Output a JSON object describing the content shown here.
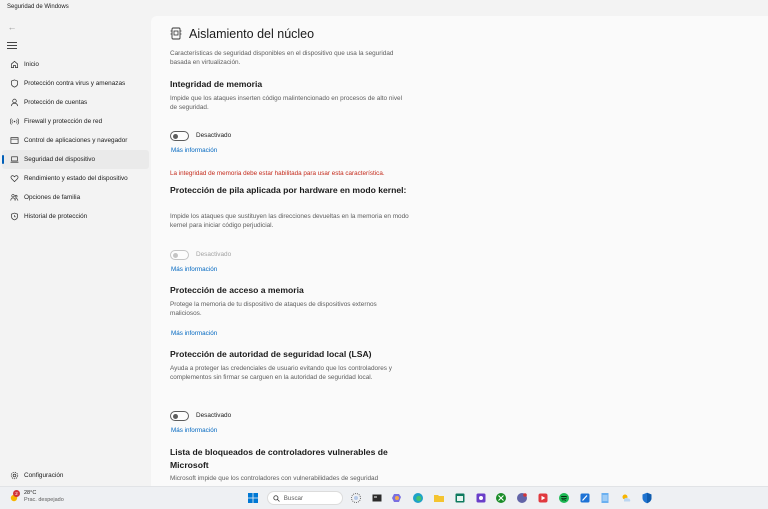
{
  "window": {
    "title": "Seguridad de Windows"
  },
  "nav": {
    "items": [
      {
        "label": "Inicio",
        "icon": "home-icon",
        "active": false
      },
      {
        "label": "Protección contra virus y amenazas",
        "icon": "shield-icon",
        "active": false
      },
      {
        "label": "Protección de cuentas",
        "icon": "person-icon",
        "active": false
      },
      {
        "label": "Firewall y protección de red",
        "icon": "wifi-antenna-icon",
        "active": false
      },
      {
        "label": "Control de aplicaciones y navegador",
        "icon": "app-window-icon",
        "active": false
      },
      {
        "label": "Seguridad del dispositivo",
        "icon": "laptop-icon",
        "active": true
      },
      {
        "label": "Rendimiento y estado del dispositivo",
        "icon": "heart-icon",
        "active": false
      },
      {
        "label": "Opciones de familia",
        "icon": "family-icon",
        "active": false
      },
      {
        "label": "Historial de protección",
        "icon": "history-icon",
        "active": false
      }
    ],
    "settings": {
      "label": "Configuración",
      "icon": "gear-icon"
    }
  },
  "page": {
    "title": "Aislamiento del núcleo",
    "description": "Características de seguridad disponibles en el dispositivo que usa la seguridad basada en virtualización.",
    "sections": {
      "memory_integrity": {
        "heading": "Integridad de memoria",
        "description": "Impide que los ataques inserten código malintencionado en procesos de alto nivel de seguridad.",
        "toggle_label": "Desactivado",
        "toggle_on": false,
        "link": "Más información"
      },
      "stack_protection": {
        "warning": "La integridad de memoria debe estar habilitada para usar esta característica.",
        "heading": "Protección de pila aplicada por hardware en modo kernel:",
        "description": "Impide los ataques que sustituyen las direcciones devueltas en la memoria en modo kernel para iniciar código perjudicial.",
        "toggle_label": "Desactivado",
        "toggle_on": false,
        "toggle_disabled": true,
        "link": "Más información"
      },
      "memory_access": {
        "heading": "Protección de acceso a memoria",
        "description": "Protege la memoria de tu dispositivo de ataques de dispositivos externos maliciosos.",
        "link": "Más información"
      },
      "lsa": {
        "heading": "Protección de autoridad de seguridad local (LSA)",
        "description": "Ayuda a proteger las credenciales de usuario evitando que los controladores y complementos sin firmar se carguen en la autoridad de seguridad local.",
        "toggle_label": "Desactivado",
        "toggle_on": false,
        "link": "Más información"
      },
      "driver_blocklist": {
        "heading": "Lista de bloqueados de controladores vulnerables de Microsoft",
        "description": "Microsoft impide que los controladores con vulnerabilidades de seguridad"
      }
    }
  },
  "taskbar": {
    "weather": {
      "temp": "28°C",
      "desc": "Prac. despejado",
      "badge": "2"
    },
    "search_label": "Buscar",
    "icons": [
      "windows-start-icon",
      "task-view-icon",
      "terminal-icon",
      "copilot-icon",
      "edge-icon",
      "file-explorer-icon",
      "calendar-app-icon",
      "photo-app-icon",
      "xbox-icon",
      "chat-app-icon",
      "media-app-icon",
      "spotify-icon",
      "paint-icon",
      "notepad-icon",
      "weather-app-icon",
      "windows-security-icon"
    ]
  }
}
